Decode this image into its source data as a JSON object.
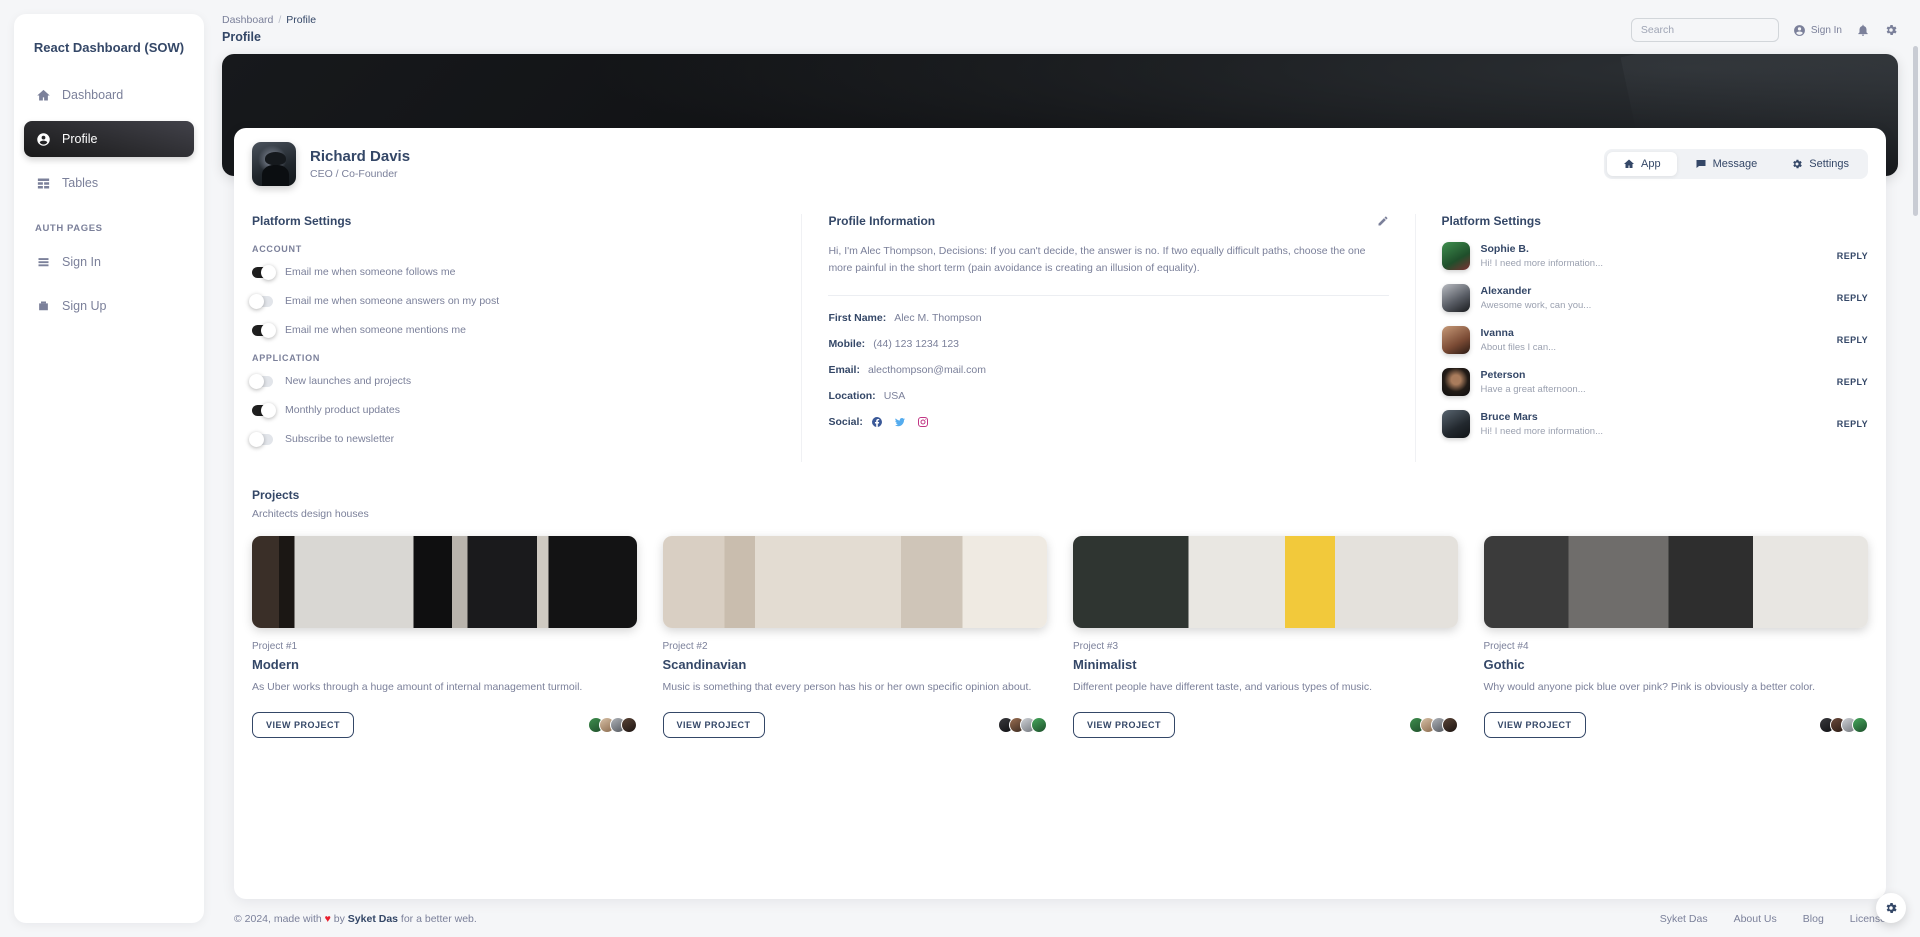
{
  "sidebar": {
    "brand": "React Dashboard (SOW)",
    "items": [
      {
        "label": "Dashboard",
        "icon": "home-icon",
        "active": false
      },
      {
        "label": "Profile",
        "icon": "account-circle-icon",
        "active": true
      },
      {
        "label": "Tables",
        "icon": "table-icon",
        "active": false
      }
    ],
    "section_label": "AUTH PAGES",
    "auth_items": [
      {
        "label": "Sign In",
        "icon": "login-icon"
      },
      {
        "label": "Sign Up",
        "icon": "signup-icon"
      }
    ]
  },
  "header": {
    "breadcrumb_root": "Dashboard",
    "breadcrumb_sep": "/",
    "breadcrumb_current": "Profile",
    "page_title": "Profile",
    "search_placeholder": "Search",
    "search_value": "",
    "sign_in_label": "Sign In",
    "notifications_icon": "bell-icon",
    "settings_icon": "gear-icon"
  },
  "profile": {
    "name": "Richard Davis",
    "role": "CEO / Co-Founder",
    "tabs": [
      {
        "label": "App",
        "icon": "home-icon",
        "active": true
      },
      {
        "label": "Message",
        "icon": "chat-icon",
        "active": false
      },
      {
        "label": "Settings",
        "icon": "gear-icon",
        "active": false
      }
    ]
  },
  "platform_settings": {
    "title": "Platform Settings",
    "account_label": "ACCOUNT",
    "account_items": [
      {
        "label": "Email me when someone follows me",
        "on": true
      },
      {
        "label": "Email me when someone answers on my post",
        "on": false
      },
      {
        "label": "Email me when someone mentions me",
        "on": true
      }
    ],
    "application_label": "APPLICATION",
    "application_items": [
      {
        "label": "New launches and projects",
        "on": false
      },
      {
        "label": "Monthly product updates",
        "on": true
      },
      {
        "label": "Subscribe to newsletter",
        "on": false
      }
    ]
  },
  "profile_information": {
    "title": "Profile Information",
    "edit_icon": "pencil-icon",
    "bio": "Hi, I'm Alec Thompson, Decisions: If you can't decide, the answer is no. If two equally difficult paths, choose the one more painful in the short term (pain avoidance is creating an illusion of equality).",
    "fields": [
      {
        "key": "First Name:",
        "value": "Alec M. Thompson"
      },
      {
        "key": "Mobile:",
        "value": "(44) 123 1234 123"
      },
      {
        "key": "Email:",
        "value": "alecthompson@mail.com"
      },
      {
        "key": "Location:",
        "value": "USA"
      }
    ],
    "social_key": "Social:",
    "socials": [
      {
        "name": "facebook-icon",
        "color": "#3b5998"
      },
      {
        "name": "twitter-icon",
        "color": "#55acee"
      },
      {
        "name": "instagram-icon",
        "color": "#c13584"
      }
    ]
  },
  "conversations": {
    "title": "Platform Settings",
    "reply_label": "REPLY",
    "items": [
      {
        "name": "Sophie B.",
        "message": "Hi! I need more information...",
        "avatar_color": "#2f6a3a"
      },
      {
        "name": "Alexander",
        "message": "Awesome work, can you...",
        "avatar_color": "#8d9099"
      },
      {
        "name": "Ivanna",
        "message": "About files I can...",
        "avatar_color": "#6b4a3c"
      },
      {
        "name": "Peterson",
        "message": "Have a great afternoon...",
        "avatar_color": "#1b1b1d"
      },
      {
        "name": "Bruce Mars",
        "message": "Hi! I need more information...",
        "avatar_color": "#2a3138"
      }
    ]
  },
  "projects": {
    "title": "Projects",
    "subtitle": "Architects design houses",
    "button_label": "VIEW PROJECT",
    "items": [
      {
        "number": "Project #1",
        "title": "Modern",
        "description": "As Uber works through a huge amount of internal management turmoil.",
        "img_class": "p1",
        "members": [
          "#2f6a3a",
          "#b8a08a",
          "#7d8288",
          "#33241c"
        ]
      },
      {
        "number": "Project #2",
        "title": "Scandinavian",
        "description": "Music is something that every person has his or her own specific opinion about.",
        "img_class": "p2",
        "members": [
          "#1b1b1d",
          "#6b4a3c",
          "#a9aab0",
          "#2f6a3a"
        ]
      },
      {
        "number": "Project #3",
        "title": "Minimalist",
        "description": "Different people have different taste, and various types of music.",
        "img_class": "p3",
        "members": [
          "#2f6a3a",
          "#b8a08a",
          "#7d8288",
          "#33241c"
        ]
      },
      {
        "number": "Project #4",
        "title": "Gothic",
        "description": "Why would anyone pick blue over pink? Pink is obviously a better color.",
        "img_class": "p4",
        "members": [
          "#1b1b1d",
          "#4a3a32",
          "#a9aab0",
          "#2f6a3a"
        ]
      }
    ]
  },
  "footer": {
    "copyright_prefix": "© 2024, made with",
    "heart": "♥",
    "copyright_mid": "by",
    "author": "Syket Das",
    "copyright_suffix": "for a better web.",
    "links": [
      "Syket Das",
      "About Us",
      "Blog",
      "License"
    ]
  },
  "fab": {
    "icon": "gear-icon"
  }
}
